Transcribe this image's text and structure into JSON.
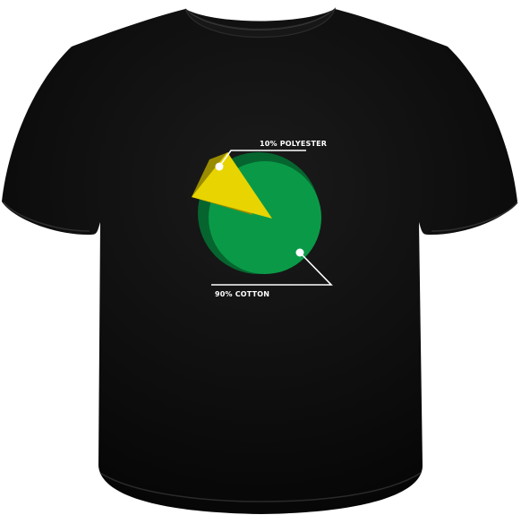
{
  "shirt": {
    "color": "#0b0b0b",
    "collar_color": "#1a1a1a"
  },
  "chart_data": {
    "type": "pie",
    "slices": [
      {
        "label": "10% POLYESTER",
        "value": 10,
        "color": "#e8d400"
      },
      {
        "label": "90% COTTON",
        "value": 90,
        "color": "#0a9a47"
      }
    ]
  },
  "colors": {
    "polyester_shadow": "#9a8c00",
    "cotton_shadow": "#06652f",
    "leader_line": "#ffffff"
  }
}
